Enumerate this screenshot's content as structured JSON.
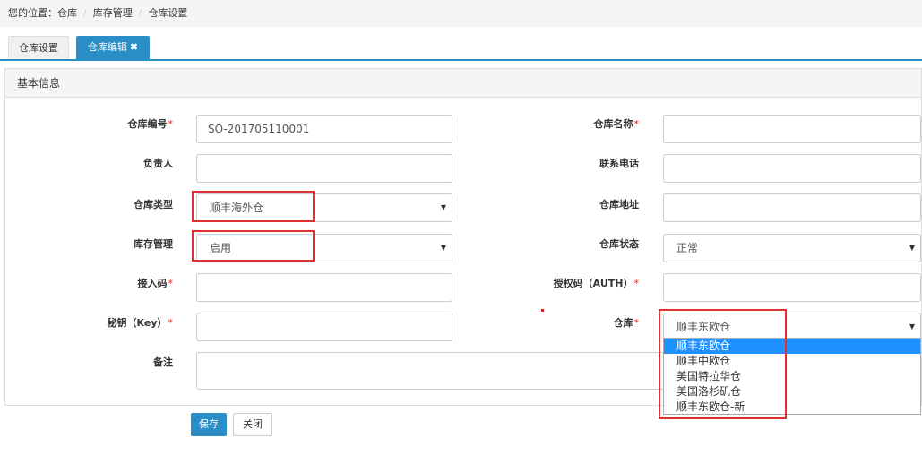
{
  "breadcrumb": {
    "prefix": "您的位置：",
    "items": [
      "仓库",
      "库存管理",
      "仓库设置"
    ]
  },
  "tabs": {
    "settings": "仓库设置",
    "edit": "仓库编辑",
    "edit_close": "✖"
  },
  "panel": {
    "title": "基本信息"
  },
  "form": {
    "code_label": "仓库编号",
    "code_value": "SO-201705110001",
    "name_label": "仓库名称",
    "owner_label": "负责人",
    "phone_label": "联系电话",
    "type_label": "仓库类型",
    "type_value": "顺丰海外仓",
    "address_label": "仓库地址",
    "stock_label": "库存管理",
    "stock_value": "启用",
    "status_label": "仓库状态",
    "status_value": "正常",
    "access_label": "接入码",
    "auth_label": "授权码（AUTH）",
    "key_label": "秘钥（Key）",
    "warehouse_label": "仓库",
    "warehouse_value": "顺丰东欧仓",
    "remark_label": "备注",
    "required_mark": "*"
  },
  "warehouse_options": [
    "顺丰东欧仓",
    "顺丰中欧仓",
    "美国特拉华仓",
    "美国洛杉矶仓",
    "顺丰东欧仓-新"
  ],
  "buttons": {
    "save": "保存",
    "close": "关闭"
  },
  "icons": {
    "caret": "caret-down-icon"
  },
  "colors": {
    "primary": "#2a8fc7",
    "highlight": "#e03030",
    "option_active": "#1e90ff"
  }
}
